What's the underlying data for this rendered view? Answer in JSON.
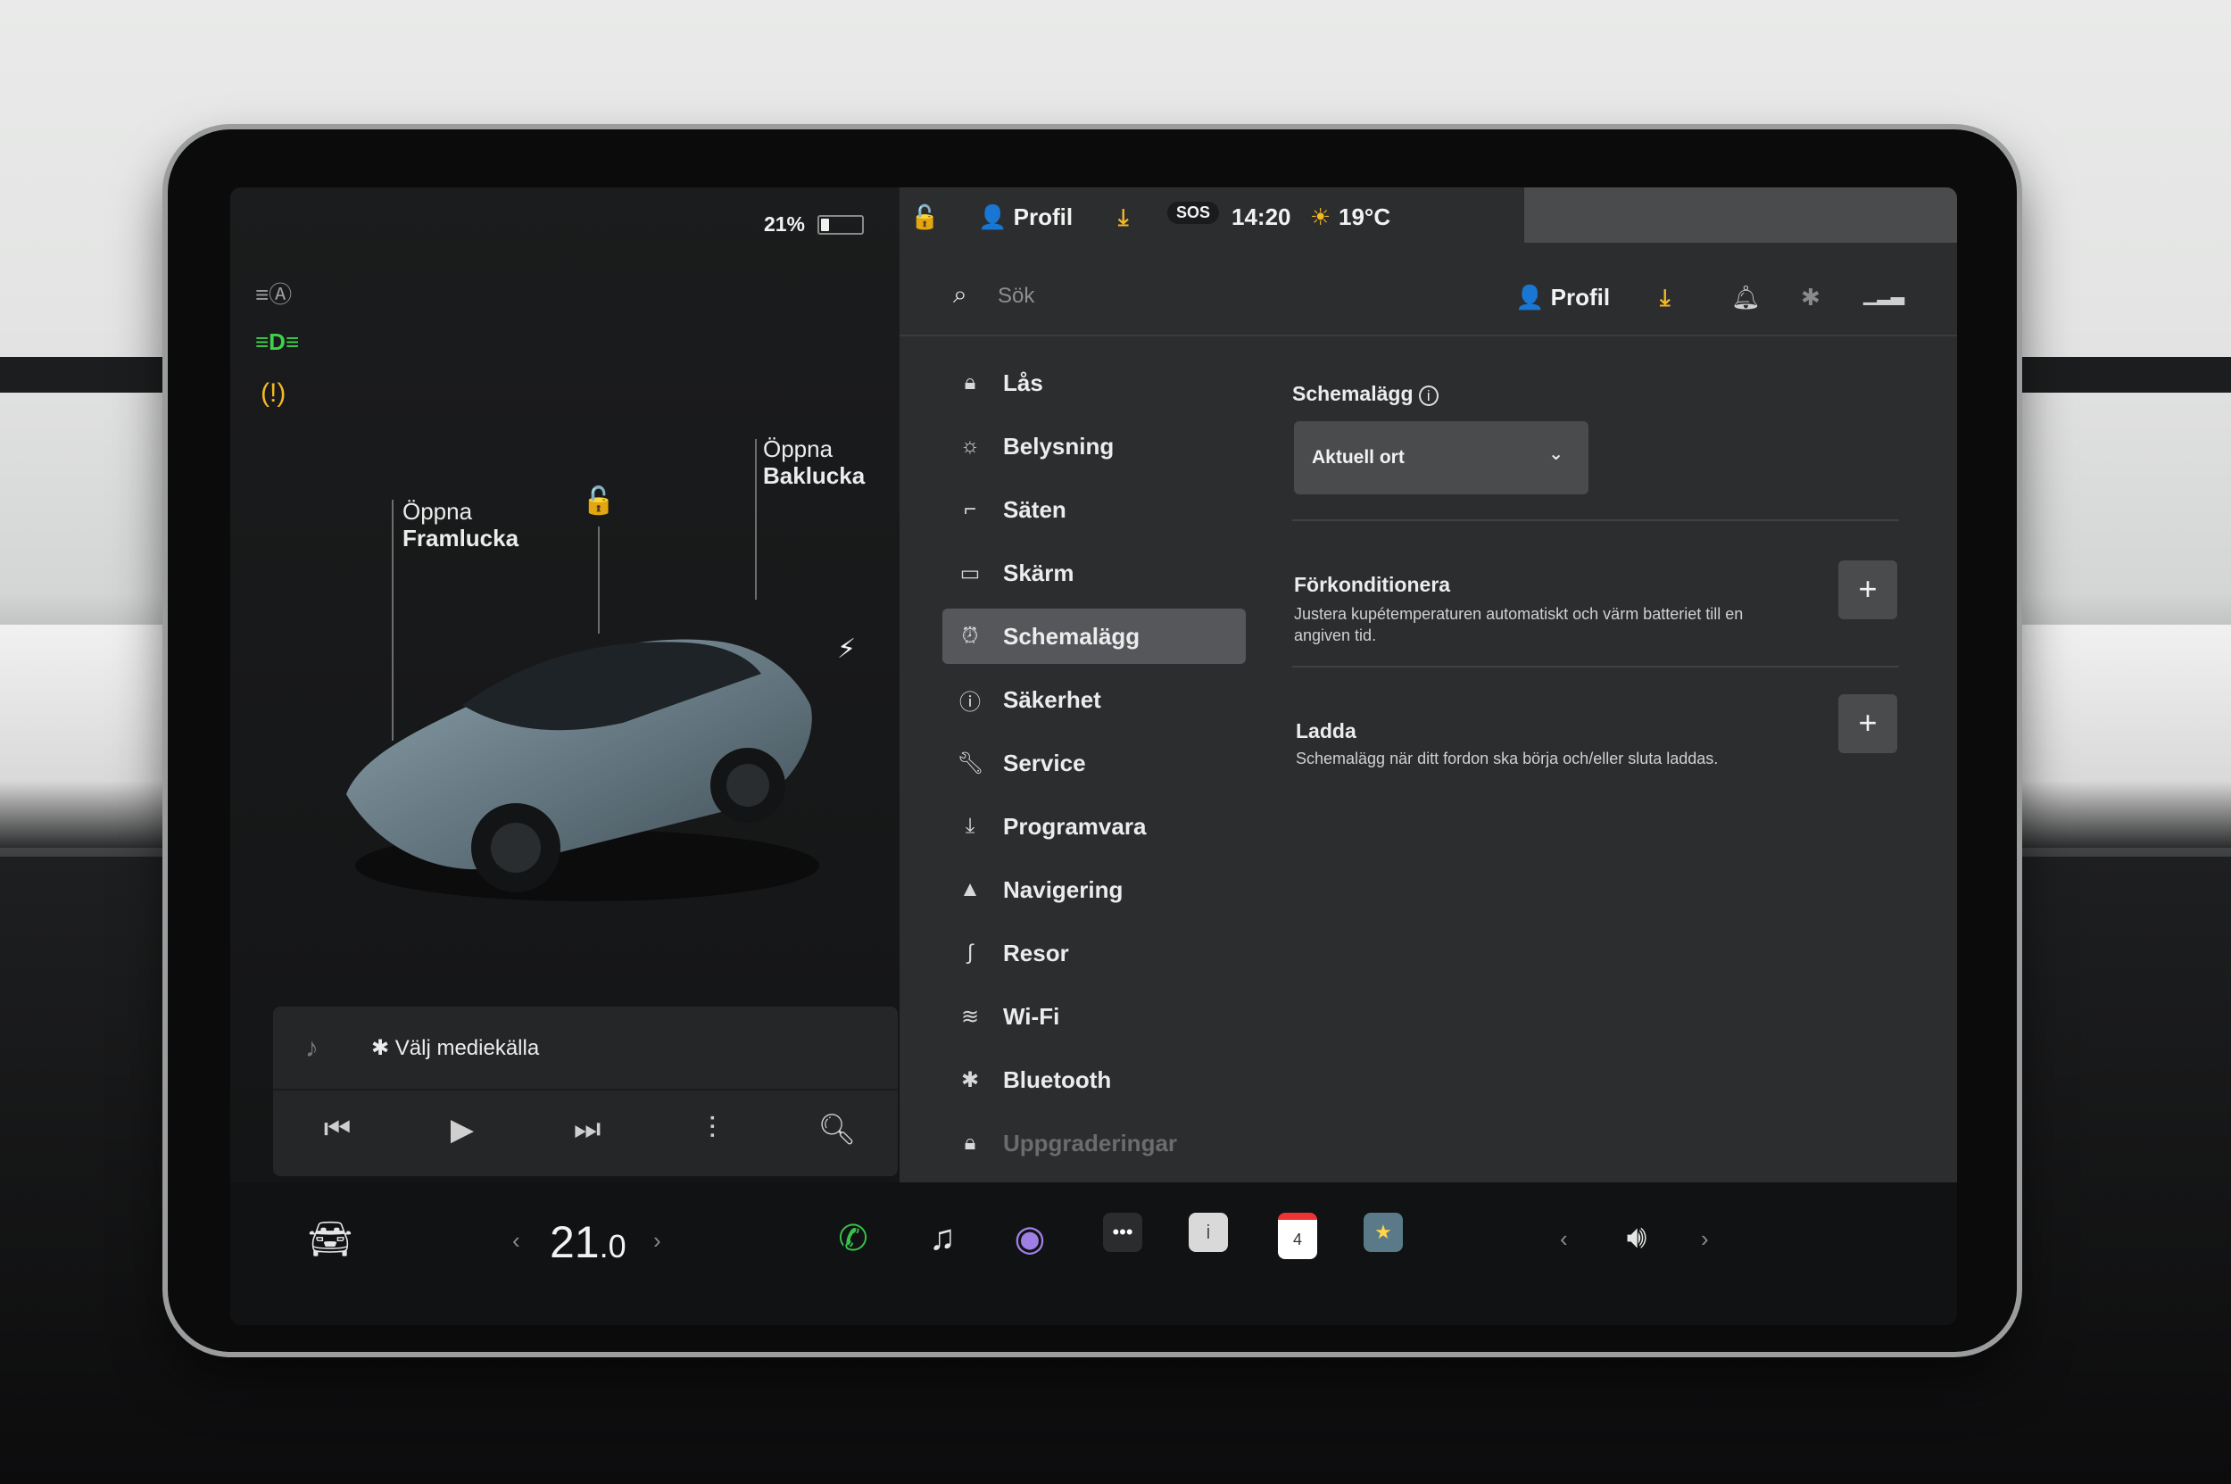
{
  "status": {
    "battery": "21%",
    "battery_level": 0.21,
    "profile": "Profil",
    "time": "14:20",
    "temperature": "19°C",
    "sos": "SOS"
  },
  "car": {
    "frunk_line1": "Öppna",
    "frunk_line2": "Framlucka",
    "trunk_line1": "Öppna",
    "trunk_line2": "Baklucka"
  },
  "media": {
    "source": "✱ Välj mediekälla"
  },
  "search": {
    "placeholder": "Sök"
  },
  "header": {
    "profile": "Profil"
  },
  "menu": {
    "items": [
      {
        "label": "Lås",
        "icon": "lock-icon"
      },
      {
        "label": "Belysning",
        "icon": "light-icon"
      },
      {
        "label": "Säten",
        "icon": "seat-icon"
      },
      {
        "label": "Skärm",
        "icon": "display-icon"
      },
      {
        "label": "Schemalägg",
        "icon": "alarm-clock-icon"
      },
      {
        "label": "Säkerhet",
        "icon": "safety-icon"
      },
      {
        "label": "Service",
        "icon": "wrench-icon"
      },
      {
        "label": "Programvara",
        "icon": "download-icon"
      },
      {
        "label": "Navigering",
        "icon": "navigation-icon"
      },
      {
        "label": "Resor",
        "icon": "trips-icon"
      },
      {
        "label": "Wi-Fi",
        "icon": "wifi-icon"
      },
      {
        "label": "Bluetooth",
        "icon": "bluetooth-icon"
      },
      {
        "label": "Uppgraderingar",
        "icon": "upgrades-icon"
      }
    ]
  },
  "schedule": {
    "title": "Schemalägg",
    "location": "Aktuell ort",
    "precondition_title": "Förkonditionera",
    "precondition_desc": "Justera kupétemperaturen automatiskt och värm batteriet till en angiven tid.",
    "charge_title": "Ladda",
    "charge_desc": "Schemalägg när ditt fordon ska börja och/eller sluta laddas."
  },
  "taskbar": {
    "temp_main": "21",
    "temp_decimal": ".0",
    "calendar_day": "4"
  },
  "colors": {
    "accent_yellow": "#f2b824",
    "indicator_green": "#3fd14a",
    "phone_green": "#38c24a",
    "active_menu": "#55575a"
  }
}
